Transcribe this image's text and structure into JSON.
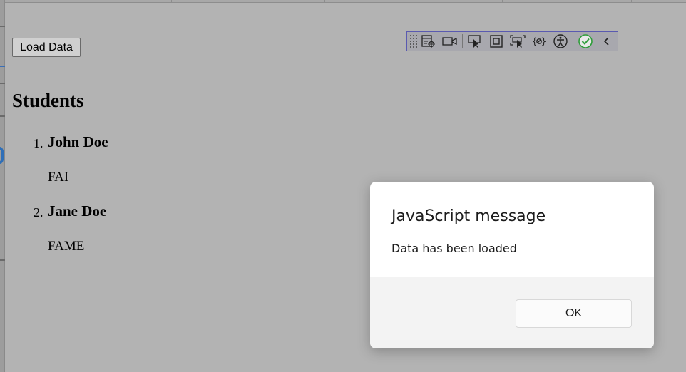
{
  "page": {
    "load_button_label": "Load Data",
    "heading": "Students"
  },
  "students": [
    {
      "number": "1.",
      "name": "John Doe",
      "department": "FAI"
    },
    {
      "number": "2.",
      "name": "Jane Doe",
      "department": "FAME"
    }
  ],
  "devtools": {
    "tools": [
      "live-visual-tree-icon",
      "video-capture-icon",
      "select-element-icon",
      "display-layout-adorners-icon",
      "track-focus-icon",
      "binding-failures-icon",
      "accessibility-icon",
      "hot-reload-status-icon",
      "collapse-toolbar-icon"
    ]
  },
  "dialog": {
    "title": "JavaScript message",
    "message": "Data has been loaded",
    "ok_label": "OK"
  },
  "colors": {
    "overlay": "#b3b3b3",
    "dialog_bg": "#ffffff",
    "dialog_footer": "#f3f3f3",
    "hot_reload_ok": "#2e9e3a"
  }
}
